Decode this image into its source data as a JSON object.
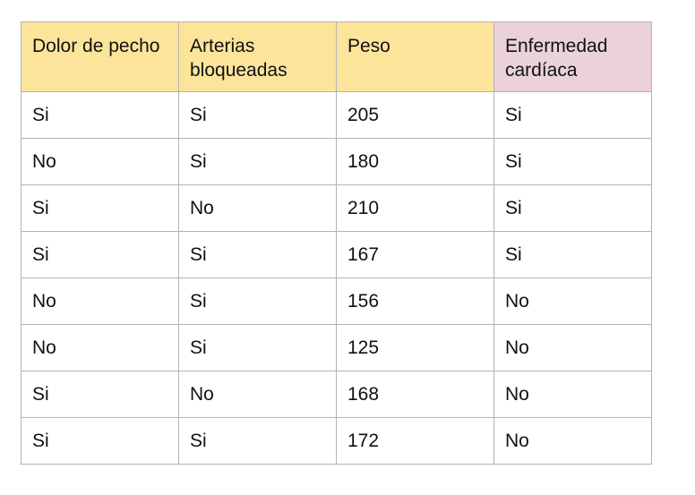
{
  "table": {
    "header_color": "#fde49b",
    "target_header_color": "#ead1dc",
    "headers": [
      "Dolor de pecho",
      "Arterias bloqueadas",
      "Peso",
      "Enfermedad cardíaca"
    ],
    "rows": [
      [
        "Si",
        "Si",
        "205",
        "Si"
      ],
      [
        "No",
        "Si",
        "180",
        "Si"
      ],
      [
        "Si",
        "No",
        "210",
        "Si"
      ],
      [
        "Si",
        "Si",
        "167",
        "Si"
      ],
      [
        "No",
        "Si",
        "156",
        "No"
      ],
      [
        "No",
        "Si",
        "125",
        "No"
      ],
      [
        "Si",
        "No",
        "168",
        "No"
      ],
      [
        "Si",
        "Si",
        "172",
        "No"
      ]
    ]
  }
}
